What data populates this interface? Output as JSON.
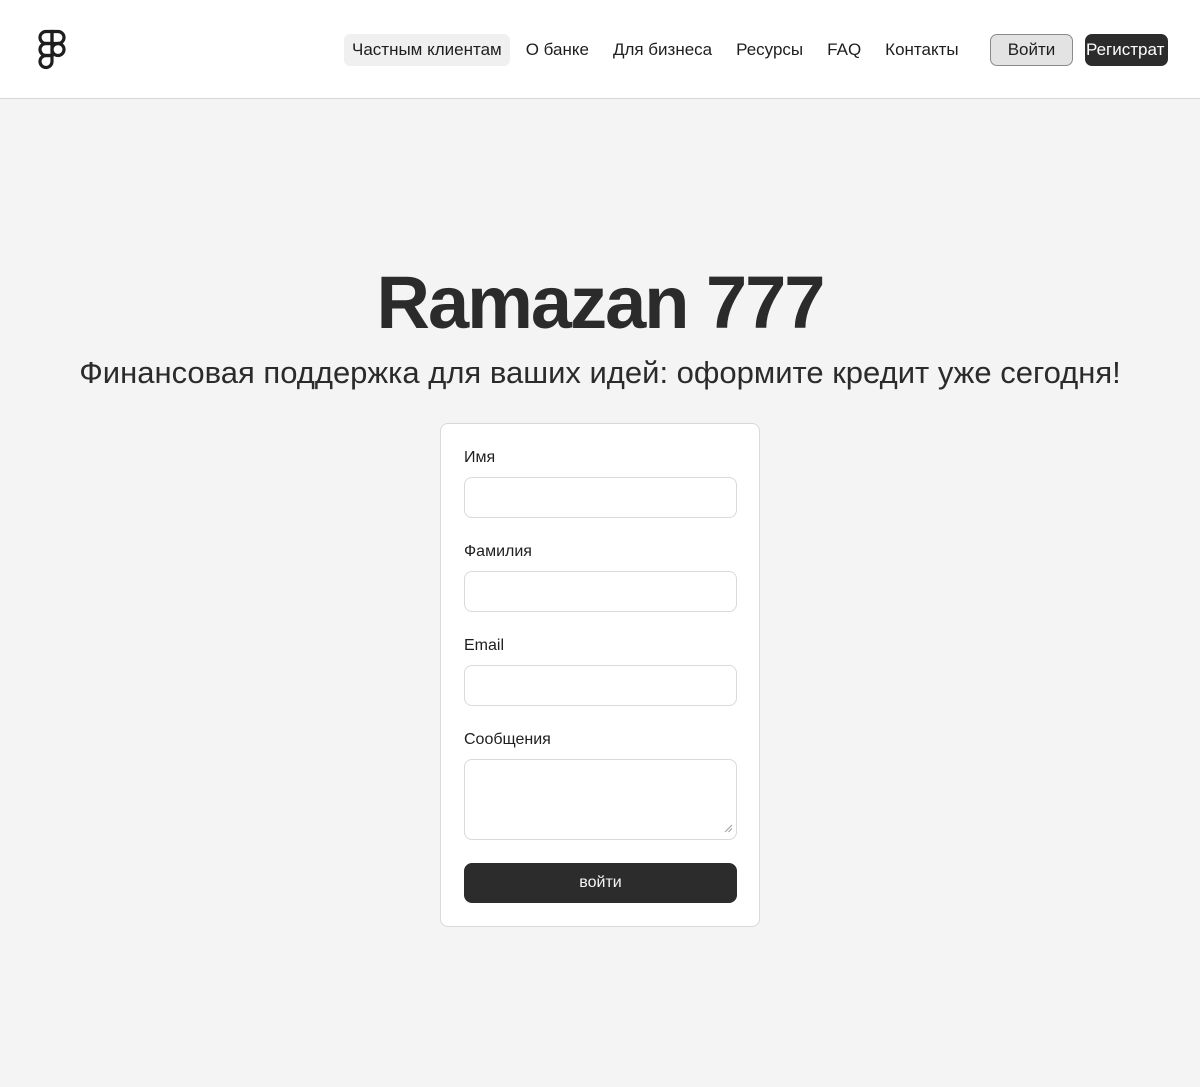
{
  "header": {
    "logo_icon": "figma-logo-icon",
    "nav": [
      {
        "label": "Частным клиентам",
        "active": true
      },
      {
        "label": "О банке",
        "active": false
      },
      {
        "label": "Для бизнеса",
        "active": false
      },
      {
        "label": "Ресурсы",
        "active": false
      },
      {
        "label": "FAQ",
        "active": false
      },
      {
        "label": "Контакты",
        "active": false
      }
    ],
    "login_label": "Войти",
    "register_label": "Регистрат"
  },
  "hero": {
    "title": "Ramazan 777",
    "subtitle": "Финансовая поддержка для ваших идей: оформите кредит уже сегодня!"
  },
  "form": {
    "fields": [
      {
        "label": "Имя",
        "value": "",
        "placeholder": ""
      },
      {
        "label": "Фамилия",
        "value": "",
        "placeholder": ""
      },
      {
        "label": "Email",
        "value": "",
        "placeholder": ""
      }
    ],
    "message": {
      "label": "Сообщения",
      "value": "",
      "placeholder": ""
    },
    "submit_label": "войти"
  },
  "colors": {
    "background": "#f4f4f4",
    "header_bg": "#ffffff",
    "primary_dark": "#2c2c2c",
    "secondary_button": "#e3e3e3",
    "border": "#d9d9d9"
  }
}
